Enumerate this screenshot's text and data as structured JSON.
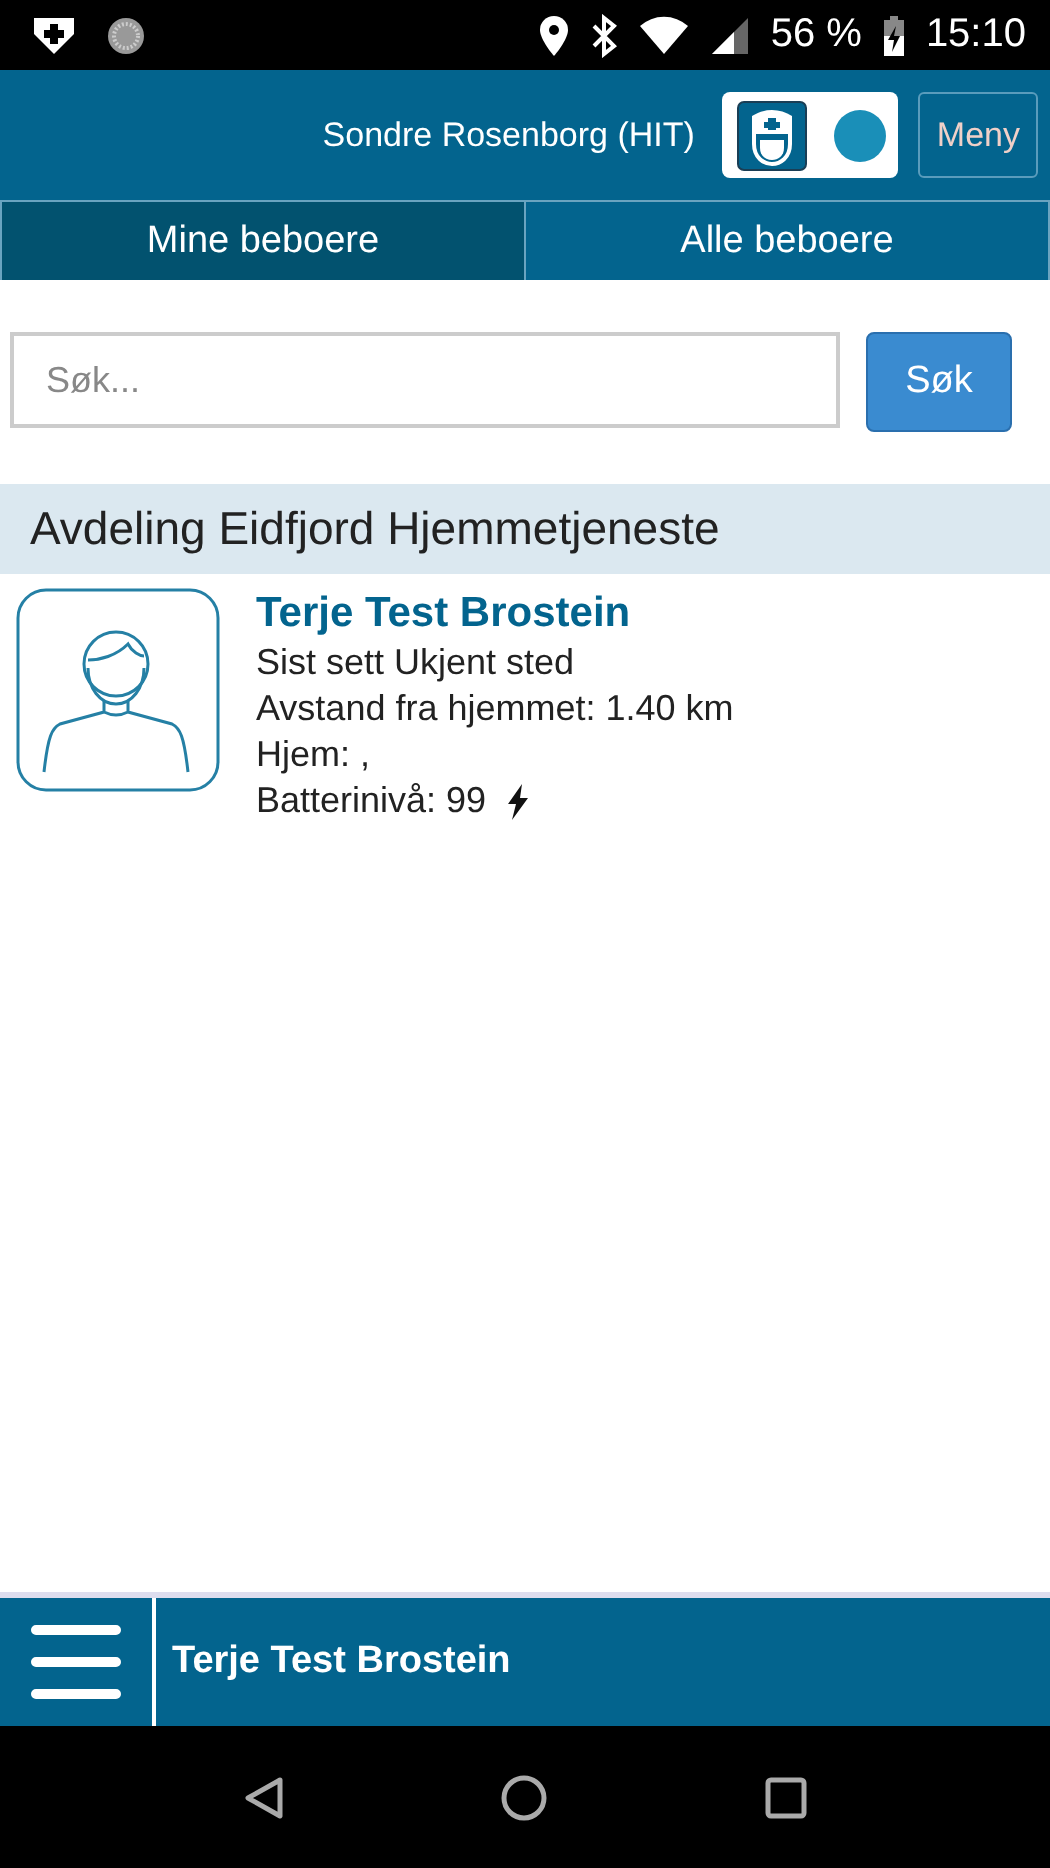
{
  "status_bar": {
    "battery": "56 %",
    "time": "15:10"
  },
  "header": {
    "user": "Sondre Rosenborg (HIT)",
    "menu_button": "Meny",
    "status_on": true
  },
  "tabs": [
    {
      "label": "Mine beboere",
      "selected": true
    },
    {
      "label": "Alle beboere",
      "selected": false
    }
  ],
  "search": {
    "placeholder": "Søk...",
    "button": "Søk"
  },
  "section": {
    "title": "Avdeling Eidfjord Hjemmetjeneste"
  },
  "residents": [
    {
      "name": "Terje Test Brostein",
      "lines": [
        "Sist sett Ukjent sted",
        "Avstand fra hjemmet: 1.40 km",
        "Hjem: ,"
      ],
      "battery": "Batterinivå: 99",
      "charging": true
    }
  ],
  "bottom_bar": {
    "title": "Terje Test Brostein"
  }
}
